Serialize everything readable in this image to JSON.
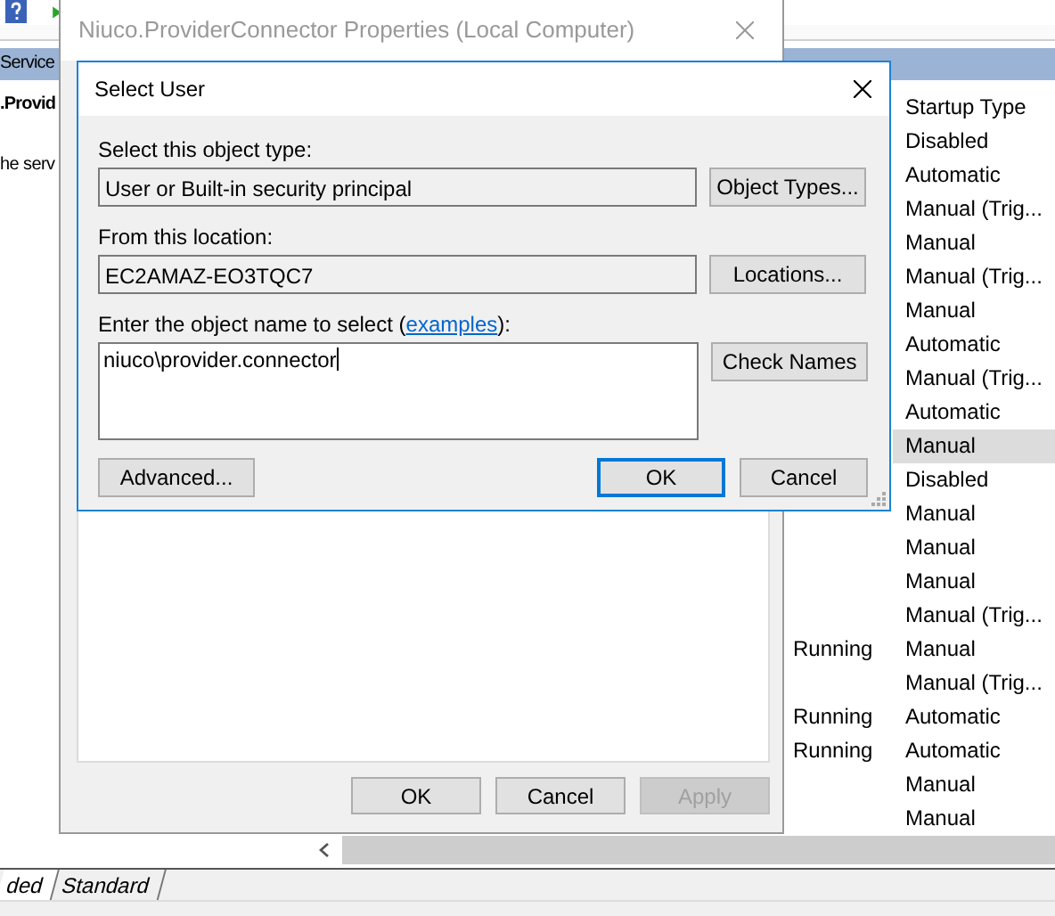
{
  "services": {
    "header_title": "Service",
    "service_name": ".Provid",
    "description": "he serv",
    "column_header": "Startup Type",
    "rows": [
      {
        "startup": "Disabled",
        "selected": false
      },
      {
        "startup": "Automatic",
        "selected": false
      },
      {
        "startup": "Manual (Trig...",
        "selected": false
      },
      {
        "startup": "Manual",
        "selected": false
      },
      {
        "startup": "Manual (Trig...",
        "selected": false
      },
      {
        "startup": "Manual",
        "selected": false
      },
      {
        "startup": "Automatic",
        "selected": false
      },
      {
        "startup": "Manual (Trig...",
        "selected": false
      },
      {
        "startup": "Automatic",
        "selected": false
      },
      {
        "startup": "Manual",
        "selected": true
      },
      {
        "startup": "Disabled",
        "selected": false
      },
      {
        "startup": "Manual",
        "selected": false
      },
      {
        "startup": "Manual",
        "selected": false
      },
      {
        "startup": "Manual",
        "selected": false
      },
      {
        "startup": "Manual (Trig...",
        "selected": false
      },
      {
        "status": "Running",
        "startup": "Manual",
        "selected": false
      },
      {
        "startup": "Manual (Trig...",
        "selected": false
      },
      {
        "status": "Running",
        "startup": "Automatic",
        "selected": false
      },
      {
        "status": "Running",
        "startup": "Automatic",
        "selected": false
      },
      {
        "startup": "Manual",
        "selected": false
      },
      {
        "startup": "Manual",
        "selected": false
      }
    ],
    "tabs": [
      {
        "label": "ded",
        "selected": true
      },
      {
        "label": "Standard",
        "selected": false
      }
    ]
  },
  "properties": {
    "title": "Niuco.ProviderConnector Properties (Local Computer)",
    "buttons": [
      {
        "label": "OK",
        "disabled": false
      },
      {
        "label": "Cancel",
        "disabled": false
      },
      {
        "label": "Apply",
        "disabled": true
      }
    ]
  },
  "select_user": {
    "title": "Select User",
    "object_type_label": "Select this object type:",
    "object_type": "User or Built-in security principal",
    "object_types_button": "Object Types...",
    "location_label": "From this location:",
    "location": "EC2AMAZ-EO3TQC7",
    "locations_button": "Locations...",
    "name_label_before": "Enter the object name to select (",
    "name_label_link": "examples",
    "name_label_after": "):",
    "name_value": "niuco\\provider.connector",
    "check_names_button": "Check Names",
    "advanced_button": "Advanced...",
    "ok_button": "OK",
    "cancel_button": "Cancel"
  }
}
